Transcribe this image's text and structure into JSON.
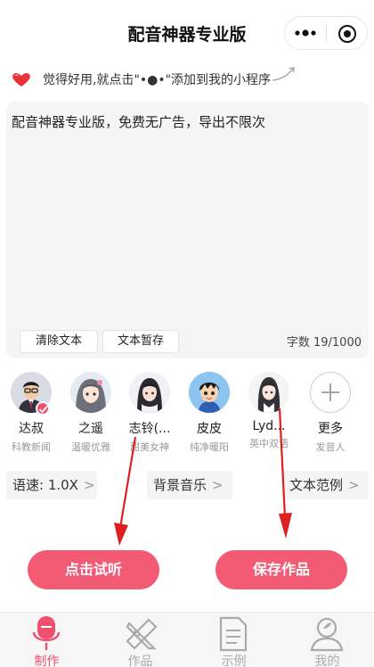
{
  "app": {
    "title": "配音神器专业版"
  },
  "tip": {
    "text": "觉得好用,就点击\"•●•\"添加到我的小程序"
  },
  "editor": {
    "content": "配音神器专业版，免费无广告，导出不限次",
    "clear_label": "清除文本",
    "save_label": "文本暂存",
    "count_label": "字数 19/1000"
  },
  "voices": [
    {
      "name": "达叔",
      "desc": "科教新闻",
      "selected": true
    },
    {
      "name": "之遥",
      "desc": "温暖优雅"
    },
    {
      "name": "志铃(...",
      "desc": "甜美女神"
    },
    {
      "name": "皮皮",
      "desc": "纯净暖阳"
    },
    {
      "name": "Lyd...",
      "desc": "英中双语"
    },
    {
      "name": "更多",
      "desc": "发音人"
    }
  ],
  "options": {
    "speed": "语速: 1.0X",
    "music": "背景音乐",
    "sample": "文本范例",
    "chevron": ">"
  },
  "actions": {
    "listen": "点击试听",
    "save": "保存作品"
  },
  "tabs": [
    {
      "label": "制作",
      "icon": "microphone-icon",
      "active": true
    },
    {
      "label": "作品",
      "icon": "pencil-ruler-icon"
    },
    {
      "label": "示例",
      "icon": "document-icon"
    },
    {
      "label": "我的",
      "icon": "user-icon"
    }
  ],
  "colors": {
    "accent": "#f35a74",
    "tab_active": "#f0506e",
    "arrow": "#e02020"
  }
}
